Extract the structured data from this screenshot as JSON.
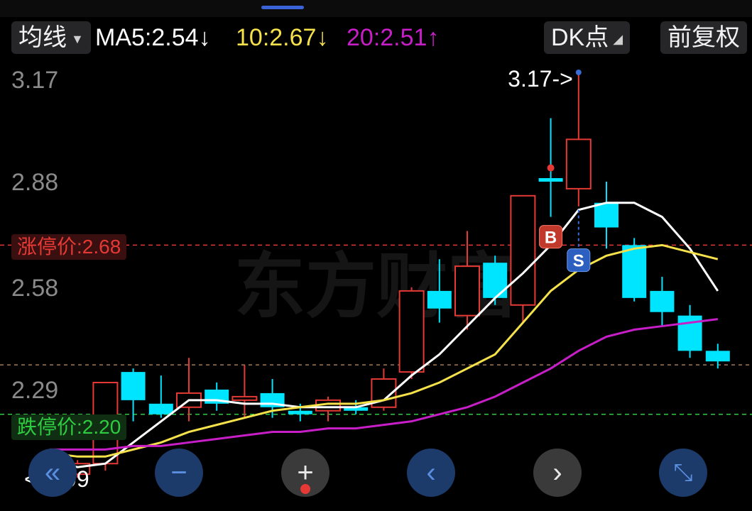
{
  "toolbar": {
    "ma_selector": "均线",
    "ma5_label": "MA5:2.54",
    "ma5_arrow": "↓",
    "ma10_label": "10:2.67",
    "ma10_arrow": "↓",
    "ma20_label": "20:2.51",
    "ma20_arrow": "↑",
    "dk_button": "DK点",
    "adjust_button": "前复权"
  },
  "watermark": "东方财富",
  "price_labels": {
    "limit_up": "涨停价:2.68",
    "limit_down": "跌停价:2.20",
    "high_marker": "3.17->",
    "low_marker": "<-1.99",
    "buy_signal": "B",
    "sell_signal": "S"
  },
  "colors": {
    "up": "#e53935",
    "down": "#00e5ff",
    "ma5": "#ffffff",
    "ma10": "#f5e14a",
    "ma20": "#c81ec8",
    "limit_up": "#e53935",
    "limit_down": "#2ecc40"
  },
  "controls": [
    {
      "icon": "double-chevron-left-icon",
      "label": "«"
    },
    {
      "icon": "zoom-out-icon",
      "label": "−"
    },
    {
      "icon": "crosshair-add-icon",
      "label": "+"
    },
    {
      "icon": "chevron-left-icon",
      "label": "‹"
    },
    {
      "icon": "chevron-right-icon",
      "label": "›"
    },
    {
      "icon": "fullscreen-icon",
      "label": "⤡"
    }
  ],
  "chart_data": {
    "type": "candlestick",
    "y_ticks": [
      "3.17",
      "2.88",
      "2.58",
      "2.29"
    ],
    "ylim": [
      1.99,
      3.17
    ],
    "limit_up_price": 2.68,
    "limit_down_price": 2.2,
    "current_price_line": 2.34,
    "candles": [
      {
        "open": 2.08,
        "close": 2.04,
        "high": 2.09,
        "low": 1.99
      },
      {
        "open": 2.03,
        "close": 2.06,
        "high": 2.07,
        "low": 2.02
      },
      {
        "open": 2.06,
        "close": 2.29,
        "high": 2.29,
        "low": 2.04
      },
      {
        "open": 2.32,
        "close": 2.24,
        "high": 2.33,
        "low": 2.18
      },
      {
        "open": 2.23,
        "close": 2.2,
        "high": 2.31,
        "low": 2.19
      },
      {
        "open": 2.22,
        "close": 2.26,
        "high": 2.36,
        "low": 2.18
      },
      {
        "open": 2.27,
        "close": 2.23,
        "high": 2.29,
        "low": 2.21
      },
      {
        "open": 2.24,
        "close": 2.25,
        "high": 2.34,
        "low": 2.19
      },
      {
        "open": 2.26,
        "close": 2.22,
        "high": 2.3,
        "low": 2.19
      },
      {
        "open": 2.21,
        "close": 2.2,
        "high": 2.23,
        "low": 2.18
      },
      {
        "open": 2.21,
        "close": 2.24,
        "high": 2.25,
        "low": 2.18
      },
      {
        "open": 2.22,
        "close": 2.21,
        "high": 2.24,
        "low": 2.2
      },
      {
        "open": 2.22,
        "close": 2.3,
        "high": 2.33,
        "low": 2.21
      },
      {
        "open": 2.32,
        "close": 2.55,
        "high": 2.56,
        "low": 2.3
      },
      {
        "open": 2.55,
        "close": 2.5,
        "high": 2.64,
        "low": 2.46
      },
      {
        "open": 2.48,
        "close": 2.62,
        "high": 2.72,
        "low": 2.44
      },
      {
        "open": 2.63,
        "close": 2.53,
        "high": 2.65,
        "low": 2.51
      },
      {
        "open": 2.51,
        "close": 2.82,
        "high": 2.82,
        "low": 2.46
      },
      {
        "open": 2.87,
        "close": 2.86,
        "high": 3.04,
        "low": 2.76
      },
      {
        "open": 2.84,
        "close": 2.98,
        "high": 3.17,
        "low": 2.79
      },
      {
        "open": 2.8,
        "close": 2.73,
        "high": 2.86,
        "low": 2.67
      },
      {
        "open": 2.68,
        "close": 2.53,
        "high": 2.7,
        "low": 2.52
      },
      {
        "open": 2.55,
        "close": 2.49,
        "high": 2.59,
        "low": 2.45
      },
      {
        "open": 2.48,
        "close": 2.38,
        "high": 2.51,
        "low": 2.36
      },
      {
        "open": 2.38,
        "close": 2.35,
        "high": 2.4,
        "low": 2.33
      }
    ],
    "series": [
      {
        "name": "MA5",
        "values": [
          2.07,
          2.05,
          2.06,
          2.12,
          2.18,
          2.24,
          2.24,
          2.23,
          2.23,
          2.22,
          2.22,
          2.22,
          2.24,
          2.31,
          2.37,
          2.45,
          2.53,
          2.6,
          2.68,
          2.78,
          2.8,
          2.8,
          2.76,
          2.67,
          2.55
        ]
      },
      {
        "name": "MA10",
        "values": [
          2.09,
          2.08,
          2.08,
          2.1,
          2.12,
          2.15,
          2.17,
          2.19,
          2.21,
          2.22,
          2.23,
          2.23,
          2.24,
          2.26,
          2.29,
          2.33,
          2.37,
          2.46,
          2.55,
          2.61,
          2.65,
          2.67,
          2.68,
          2.66,
          2.64
        ]
      },
      {
        "name": "MA20",
        "values": [
          2.1,
          2.1,
          2.1,
          2.11,
          2.11,
          2.12,
          2.13,
          2.14,
          2.15,
          2.15,
          2.16,
          2.16,
          2.17,
          2.18,
          2.2,
          2.22,
          2.25,
          2.29,
          2.33,
          2.38,
          2.42,
          2.44,
          2.45,
          2.46,
          2.47
        ]
      }
    ],
    "buy_signal_index": 18,
    "sell_signal_index": 19
  }
}
